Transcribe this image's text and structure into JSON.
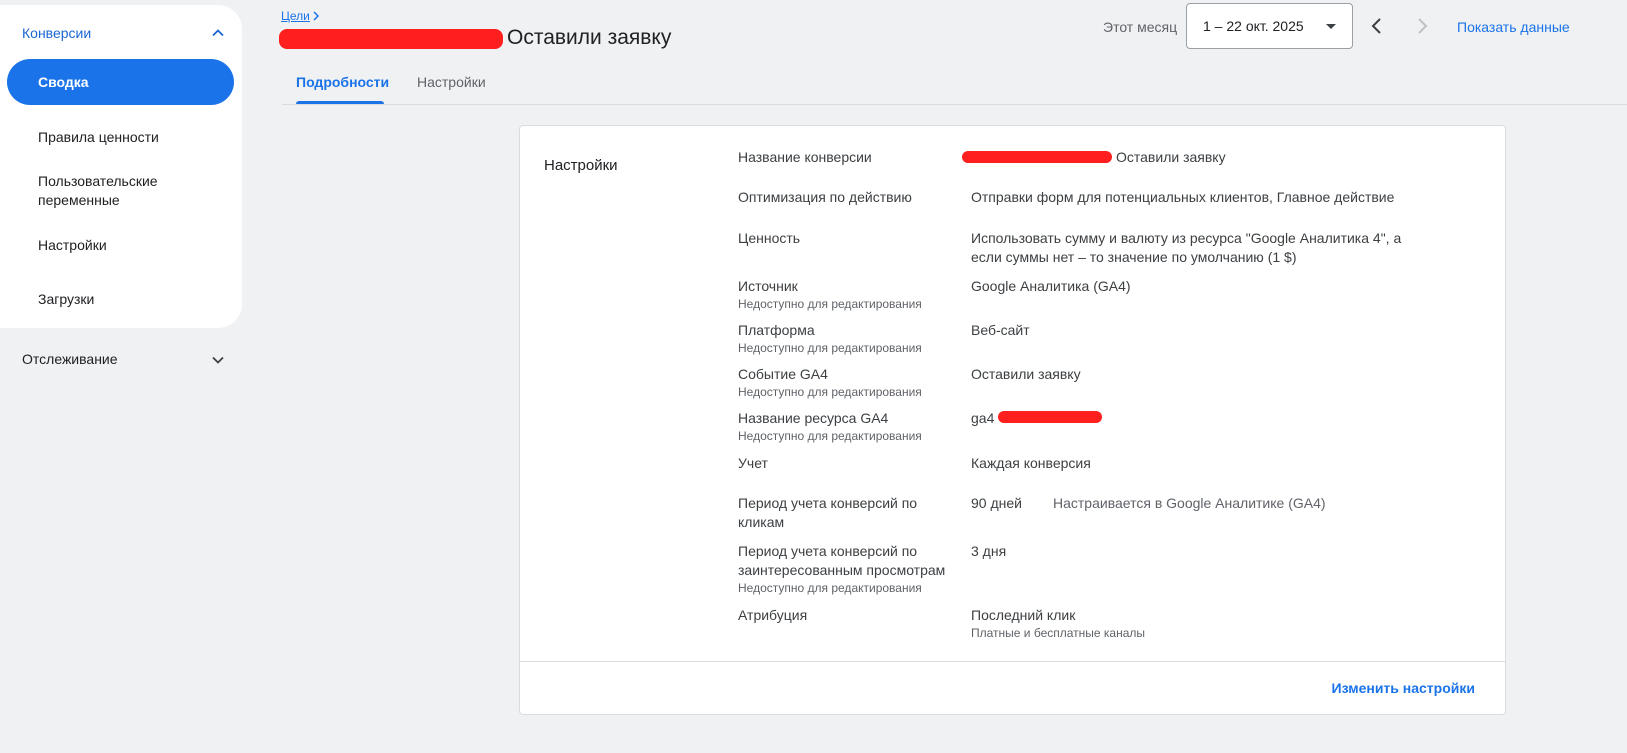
{
  "sidebar": {
    "conversions_label": "Конверсии",
    "items": [
      {
        "label": "Сводка",
        "active": true
      },
      {
        "label": "Правила ценности"
      },
      {
        "label": "Пользовательские переменные"
      },
      {
        "label": "Настройки"
      },
      {
        "label": "Загрузки"
      }
    ],
    "tracking_label": "Отслеживание"
  },
  "header": {
    "breadcrumb": "Цели",
    "title": "Оставили заявку",
    "period_label": "Этот месяц",
    "date_range": "1 – 22 окт. 2025",
    "show_data": "Показать данные"
  },
  "tabs": [
    {
      "label": "Подробности",
      "active": true
    },
    {
      "label": "Настройки",
      "active": false
    }
  ],
  "settings_card": {
    "title": "Настройки",
    "rows": [
      {
        "label": "Название конверсии",
        "value": "Оставили заявку"
      },
      {
        "label": "Оптимизация по действию",
        "value": "Отправки форм для потенциальных клиентов, Главное действие"
      },
      {
        "label": "Ценность",
        "value": "Использовать сумму и валюту из ресурса \"Google Аналитика 4\", а если суммы нет – то значение по умолчанию (1 $)"
      },
      {
        "label": "Источник",
        "sublabel": "Недоступно для редактирования",
        "value": "Google Аналитика (GA4)"
      },
      {
        "label": "Платформа",
        "sublabel": "Недоступно для редактирования",
        "value": "Веб-сайт"
      },
      {
        "label": "Событие GA4",
        "sublabel": "Недоступно для редактирования",
        "value": "Оставили заявку"
      },
      {
        "label": "Название ресурса GA4",
        "sublabel": "Недоступно для редактирования",
        "value": "ga4"
      },
      {
        "label": "Учет",
        "value": "Каждая конверсия"
      },
      {
        "label": "Период учета конверсий по кликам",
        "value": "90 дней",
        "note": "Настраивается в Google Аналитике (GA4)"
      },
      {
        "label": "Период учета конверсий по заинтересованным просмотрам",
        "sublabel": "Недоступно для редактирования",
        "value": "3 дня"
      },
      {
        "label": "Атрибуция",
        "value": "Последний клик",
        "subvalue": "Платные и бесплатные каналы"
      }
    ],
    "edit_link": "Изменить настройки"
  },
  "colors": {
    "accent": "#1a73e8",
    "redaction": "#ff1f1f",
    "background": "#f0f1f3"
  }
}
